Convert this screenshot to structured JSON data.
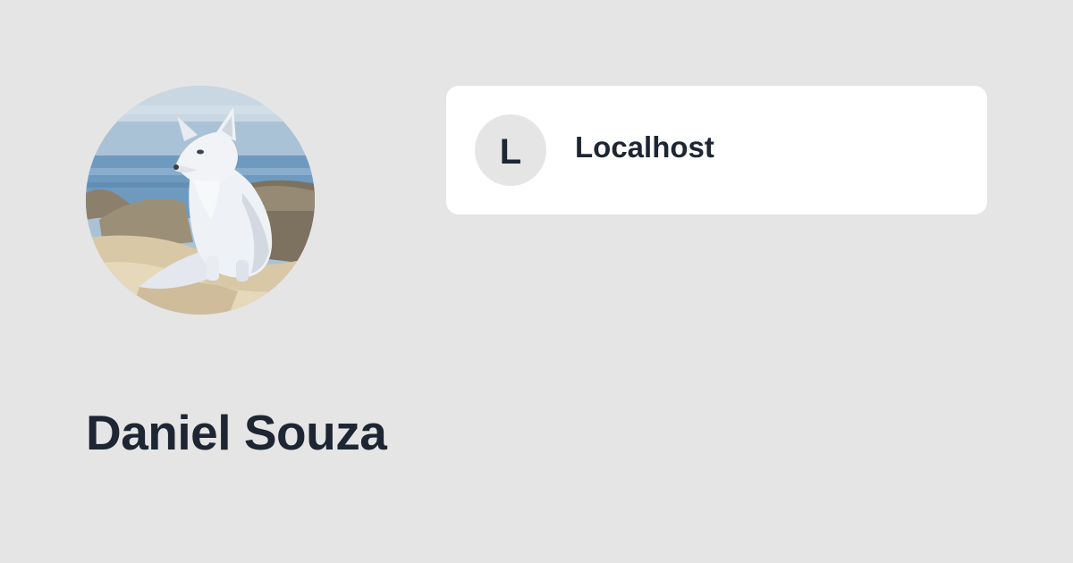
{
  "profile": {
    "name": "Daniel Souza",
    "avatar_icon": "arctic-fox-illustration"
  },
  "instance_card": {
    "initial": "L",
    "title": "Localhost"
  },
  "colors": {
    "background": "#e5e5e5",
    "card_background": "#ffffff",
    "text": "#1e2633"
  }
}
